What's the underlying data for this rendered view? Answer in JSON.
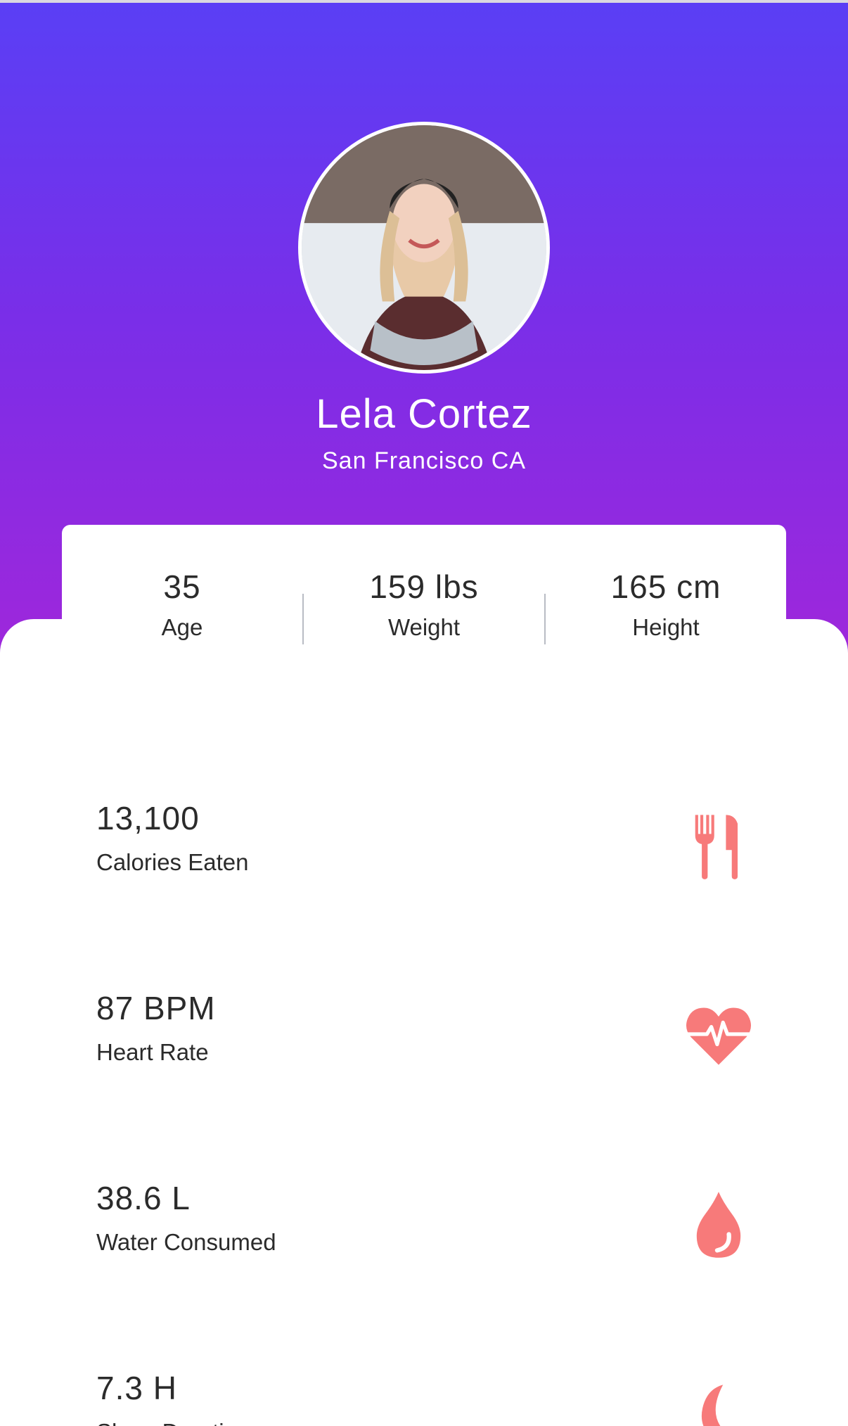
{
  "profile": {
    "name": "Lela Cortez",
    "location": "San Francisco CA"
  },
  "stats": [
    {
      "value": "35",
      "label": "Age"
    },
    {
      "value": "159 lbs",
      "label": "Weight"
    },
    {
      "value": "165 cm",
      "label": "Height"
    }
  ],
  "metrics": [
    {
      "value": "13,100",
      "label": "Calories Eaten",
      "icon": "fork-knife-icon"
    },
    {
      "value": "87 BPM",
      "label": "Heart Rate",
      "icon": "heart-rate-icon"
    },
    {
      "value": "38.6 L",
      "label": "Water Consumed",
      "icon": "water-drop-icon"
    },
    {
      "value": "7.3 H",
      "label": "Sleep Duration",
      "icon": "moon-icon"
    }
  ],
  "colors": {
    "gradient_top": "#5a3ff5",
    "gradient_bottom": "#a426d9",
    "icon_accent": "#f77a7a",
    "text": "#2b2b2b"
  }
}
